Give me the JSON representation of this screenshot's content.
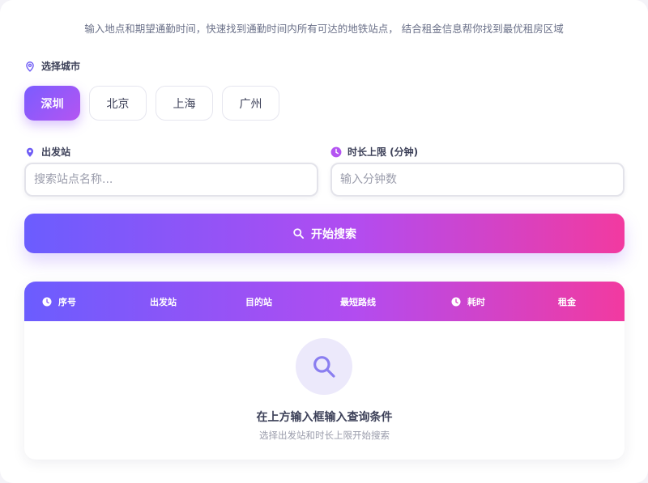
{
  "header": {
    "subtitle": "输入地点和期望通勤时间，快速找到通勤时间内所有可达的地铁站点， 结合租金信息帮你找到最优租房区域"
  },
  "city_section": {
    "label": "选择城市",
    "icon": "location-pin-outline-icon",
    "cities": [
      {
        "label": "深圳",
        "active": true
      },
      {
        "label": "北京",
        "active": false
      },
      {
        "label": "上海",
        "active": false
      },
      {
        "label": "广州",
        "active": false
      }
    ]
  },
  "form": {
    "start_station": {
      "label": "出发站",
      "icon": "location-pin-filled-icon",
      "value": "",
      "placeholder": "搜索站点名称..."
    },
    "time_limit": {
      "label": "时长上限 (分钟)",
      "icon": "clock-icon",
      "value": "",
      "placeholder": "输入分钟数"
    },
    "search_button": {
      "label": "开始搜索",
      "icon": "search-icon"
    }
  },
  "results_table": {
    "columns": [
      {
        "label": "序号",
        "icon": "clock-icon"
      },
      {
        "label": "出发站"
      },
      {
        "label": "目的站"
      },
      {
        "label": "最短路线"
      },
      {
        "label": "耗时",
        "icon": "clock-icon"
      },
      {
        "label": "租金"
      }
    ],
    "rows": [],
    "empty_state": {
      "icon": "search-icon",
      "title": "在上方输入框输入查询条件",
      "subtitle": "选择出发站和时长上限开始搜索"
    }
  },
  "colors": {
    "accent_start": "#6b5dfe",
    "accent_mid": "#b24cf0",
    "accent_end": "#f23aa0",
    "city_active": "#8a58f8",
    "pin": "#6f5df5",
    "clock": "#b455f2"
  }
}
